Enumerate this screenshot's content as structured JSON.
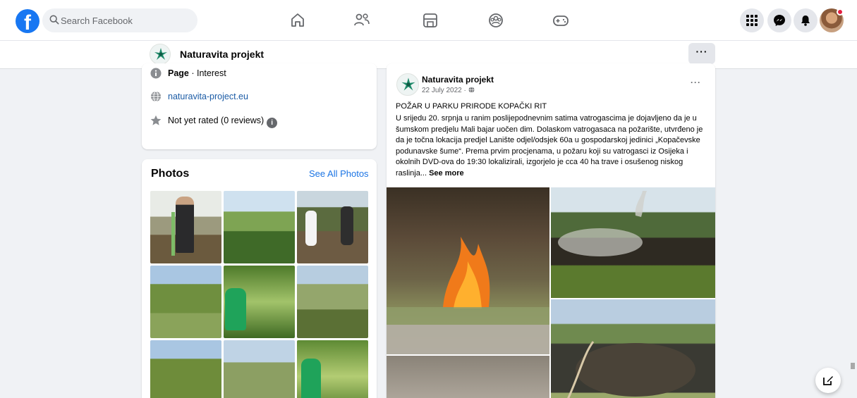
{
  "topbar": {
    "logo_letter": "f",
    "search_placeholder": "Search Facebook"
  },
  "page": {
    "name": "Naturavita projekt",
    "more_label": "···"
  },
  "intro": {
    "category_prefix": "Page",
    "category": " · Interest",
    "website": "naturavita-project.eu",
    "rating": "Not yet rated (0 reviews)",
    "info_glyph": "i"
  },
  "photos": {
    "title": "Photos",
    "see_all": "See All Photos"
  },
  "post": {
    "author": "Naturavita projekt",
    "date": "22 July 2022 · ",
    "more_label": "···",
    "headline": "POŽAR U PARKU PRIRODE KOPAČKI RIT",
    "body": " U srijedu 20. srpnja u ranim poslijepodnevnim satima vatrogascima je dojavljeno da je u šumskom predjelu Mali bajar uočen dim. Dolaskom vatrogasaca  na požarište, utvrđeno je da je točna lokacija  predjel Lanište odjel/odsjek 60a u gospodarskoj jedinici „Kopačevske podunavske šume“.  Prema prvim procjenama, u požaru koji su vatrogasci iz Osijeka i okolnih DVD-ova do 19:30 lokalizirali, izgorjelo je cca 40 ha trave i osušenog niskog raslinja... ",
    "see_more": "See more"
  },
  "colors": {
    "brand": "#1877f2",
    "link": "#1b74e4",
    "notification": "#e41e3f"
  }
}
